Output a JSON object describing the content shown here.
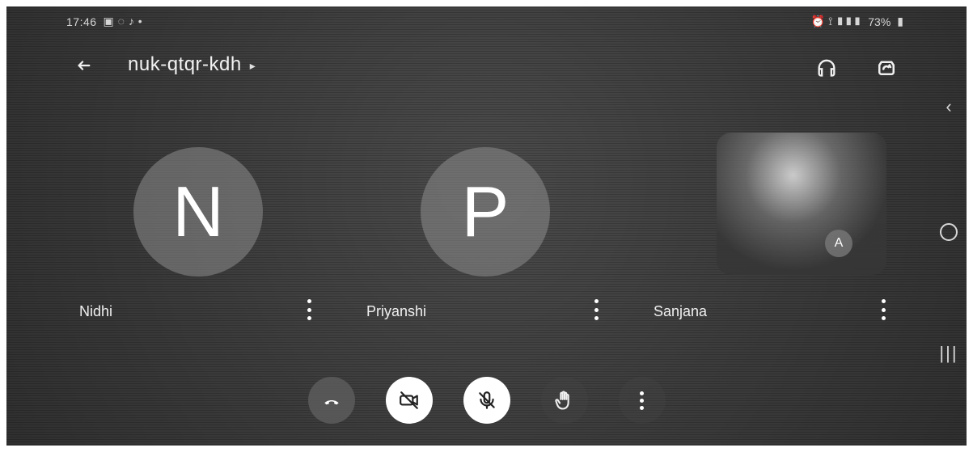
{
  "status_bar": {
    "time": "17:46",
    "battery": "73%"
  },
  "meeting": {
    "code": "nuk-qtqr-kdh"
  },
  "participants": [
    {
      "name": "Nidhi",
      "initial": "N"
    },
    {
      "name": "Priyanshi",
      "initial": "P"
    },
    {
      "name": "Sanjana",
      "initial": "A"
    }
  ],
  "icons": {
    "back": "arrow-left-icon",
    "title_caret": "chevron-right-icon",
    "audio": "headphones-icon",
    "switch_camera": "switch-camera-icon",
    "more": "more-vert-icon",
    "end_call": "end-call-icon",
    "camera_off": "video-off-icon",
    "mic_off": "mic-off-icon",
    "hand": "raise-hand-icon"
  },
  "colors": {
    "background": "#3a3a3a",
    "white": "#ffffff",
    "control_grey": "#5c5c5c"
  }
}
